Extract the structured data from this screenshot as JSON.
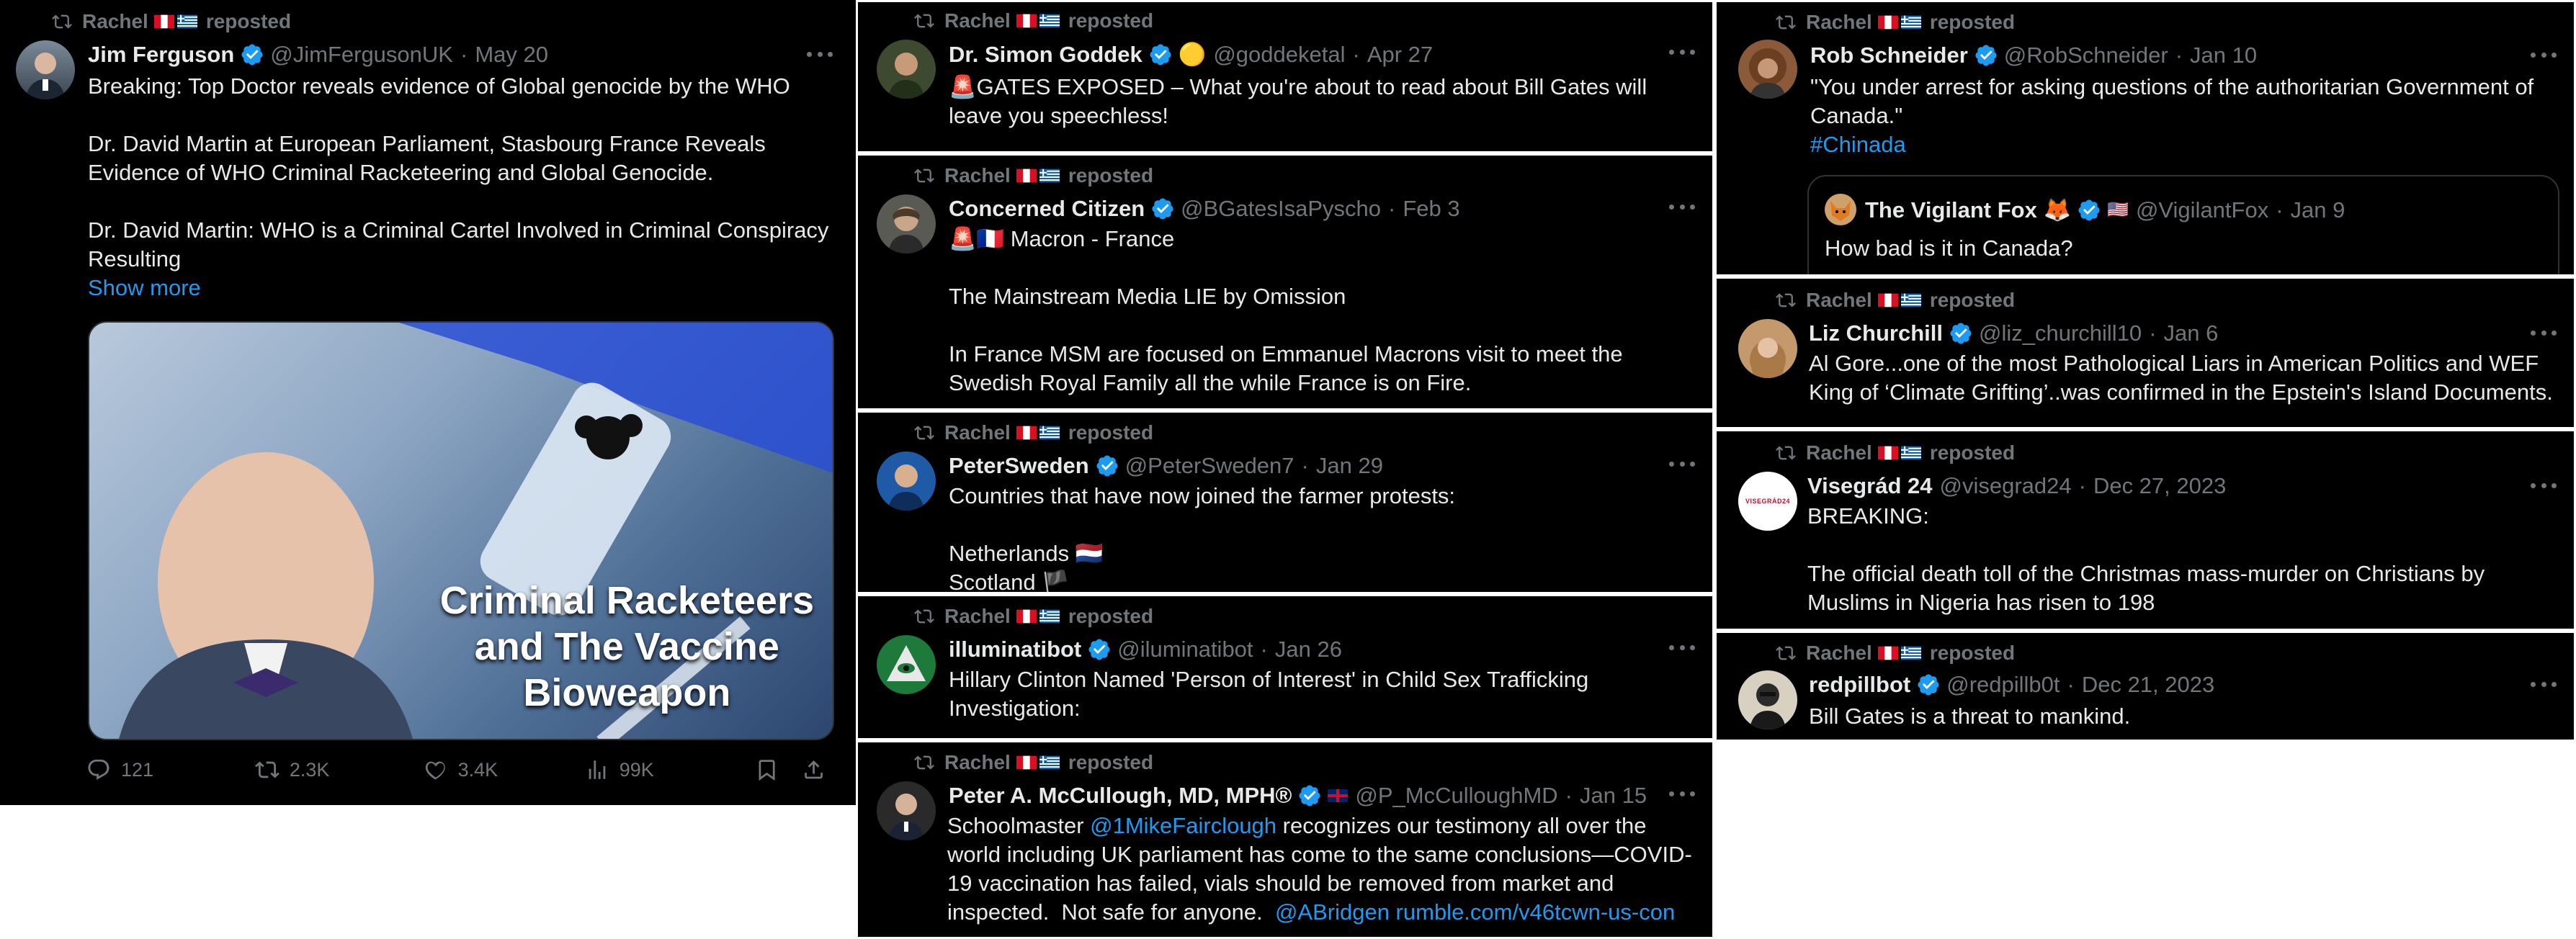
{
  "reposter": {
    "name": "Rachel",
    "label": "reposted"
  },
  "col1": {
    "author": "Jim Ferguson",
    "handle": "@JimFergusonUK",
    "date": "May 20",
    "text": "Breaking: Top Doctor reveals evidence of Global genocide by the WHO\n\nDr. David Martin at European Parliament, Stasbourg France Reveals Evidence of WHO Criminal Racketeering and Global Genocide.\n\nDr. David Martin: WHO is a Criminal Cartel Involved in Criminal Conspiracy Resulting",
    "show_more": "Show more",
    "image_caption": [
      "Criminal Racketeers",
      "and The Vaccine",
      "Bioweapon"
    ],
    "stats": {
      "replies": "121",
      "reposts": "2.3K",
      "likes": "3.4K",
      "views": "99K"
    }
  },
  "col2": [
    {
      "author": "Dr. Simon Goddek",
      "handle": "@goddeketal",
      "date": "Apr 27",
      "text": "🚨GATES EXPOSED – What you're about to read about Bill Gates will leave you speechless!"
    },
    {
      "author": "Concerned Citizen",
      "handle": "@BGatesIsaPyscho",
      "date": "Feb 3",
      "text": "🚨🇫🇷 Macron - France\n\nThe Mainstream Media LIE by Omission\n\nIn France MSM are focused on Emmanuel Macrons visit to meet the Swedish Royal Family all the while France is on Fire."
    },
    {
      "author": "PeterSweden",
      "handle": "@PeterSweden7",
      "date": "Jan 29",
      "text": "Countries that have now joined the farmer protests:\n\nNetherlands 🇳🇱\nScotland 🏴"
    },
    {
      "author": "illuminatibot",
      "handle": "@iluminatibot",
      "date": "Jan 26",
      "text": "Hillary Clinton Named 'Person of Interest' in Child Sex Trafficking Investigation:"
    },
    {
      "author": "Peter A. McCullough, MD, MPH®",
      "handle": "@P_McCulloughMD",
      "date": "Jan 15",
      "text_a": "Schoolmaster ",
      "mention": "@1MikeFaircloug​h",
      "text_b": " recognizes our testimony all over the world including UK parliament has come to the same conclusions—COVID-19 vaccination has failed, vials should be removed from market and inspected.  Not safe for anyone.  ",
      "mention2": "@ABridgen",
      "url": " rumble.com/v46tcwn-us-con"
    }
  ],
  "col3": [
    {
      "author": "Rob Schneider",
      "handle": "@RobSchneider",
      "date": "Jan 10",
      "text": "\"You under arrest for asking questions of the authoritarian Government of Canada.\"",
      "hashtag": "#Chinada",
      "quote": {
        "author": "The Vigilant Fox 🦊",
        "handle": "@VigilantFox",
        "date": "Jan 9",
        "text": "How bad is it in Canada?"
      }
    },
    {
      "author": "Liz Churchill",
      "handle": "@liz_churchill10",
      "date": "Jan 6",
      "text": "Al Gore...one of the most Pathological Liars in American Politics and WEF King of ‘Climate Grifting’..was confirmed in the Epstein's Island Documents."
    },
    {
      "author": "Visegrád 24",
      "handle": "@visegrad24",
      "date": "Dec 27, 2023",
      "text": "BREAKING:\n\nThe official death toll of the Christmas mass-murder on Christians by Muslims in Nigeria has risen to 198",
      "avatar_text": "VISEGRÁD24"
    },
    {
      "author": "redpillbot",
      "handle": "@redpillb0t",
      "date": "Dec 21, 2023",
      "text": "Bill Gates is a threat to mankind."
    }
  ],
  "colors": {
    "bg": "#000000",
    "text": "#e7e9ea",
    "muted": "#71767b",
    "link": "#1d9bf0",
    "verified": "#1d9bf0"
  }
}
